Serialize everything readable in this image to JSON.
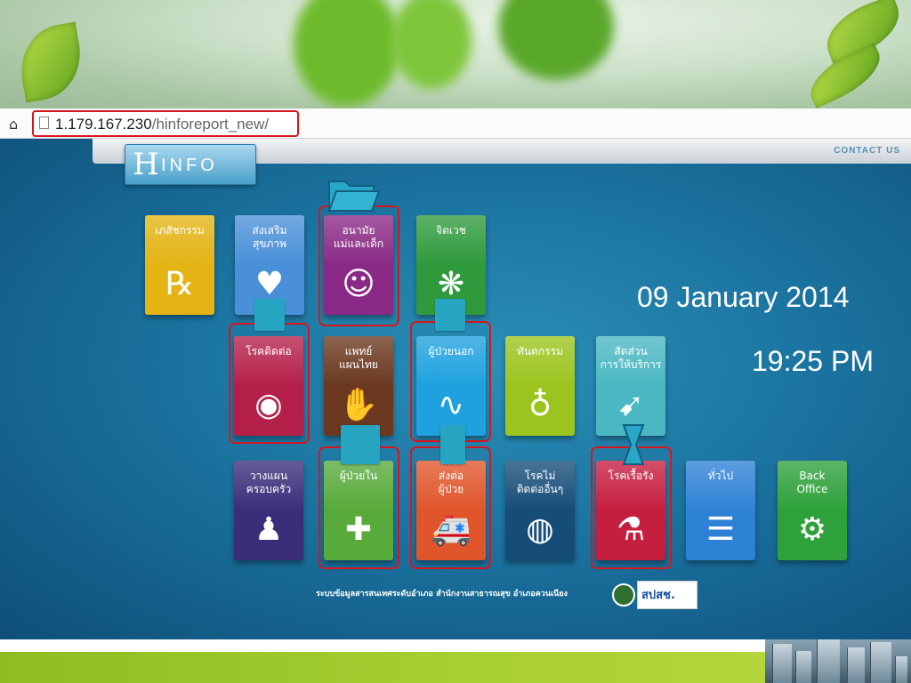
{
  "browser": {
    "home_icon": "home-icon",
    "url_host": "1.179.167.230",
    "url_path": "/hinforeport_new/"
  },
  "header": {
    "logo_first": "H",
    "logo_rest": "INFO",
    "contact_label": "CONTACT US"
  },
  "datetime": {
    "date": "09 January 2014",
    "time": "19:25 PM"
  },
  "tiles": [
    {
      "label": "เภสัชกรรม",
      "icon": "rx-icon",
      "glyph": "℞",
      "color": "#e3b414"
    },
    {
      "label": "ส่งเสริม\nสุขภาพ",
      "icon": "heart-icon",
      "glyph": "♥",
      "color": "#4a90d8"
    },
    {
      "label": "อนามัย\nแม่และเด็ก",
      "icon": "mother-child-icon",
      "glyph": "☺",
      "color": "#8a2a86"
    },
    {
      "label": "จิตเวช",
      "icon": "mind-icon",
      "glyph": "❋",
      "color": "#2f9a3c"
    },
    {
      "label": "โรคติดต่อ",
      "icon": "germ-icon",
      "glyph": "◉",
      "color": "#b5204a"
    },
    {
      "label": "แพทย์\nแผนไทย",
      "icon": "massage-icon",
      "glyph": "✋",
      "color": "#6b3820"
    },
    {
      "label": "ผู้ป่วยนอก",
      "icon": "stethoscope-icon",
      "glyph": "∿",
      "color": "#1ea1de"
    },
    {
      "label": "ทันตกรรม",
      "icon": "tooth-icon",
      "glyph": "♁",
      "color": "#9bc41e"
    },
    {
      "label": "สัดส่วน\nการให้บริการ",
      "icon": "runner-icon",
      "glyph": "➹",
      "color": "#4ab7c2"
    },
    {
      "label": "วางแผน\nครอบครัว",
      "icon": "family-icon",
      "glyph": "♟",
      "color": "#3a2e7a"
    },
    {
      "label": "ผู้ป่วยใน",
      "icon": "hospital-icon",
      "glyph": "✚",
      "color": "#58aa3a"
    },
    {
      "label": "ส่งต่อ\nผู้ป่วย",
      "icon": "ambulance-icon",
      "glyph": "🚑",
      "color": "#e0552a"
    },
    {
      "label": "โรคไม่\nติดต่ออื่นๆ",
      "icon": "blood-pressure-icon",
      "glyph": "◍",
      "color": "#164d78"
    },
    {
      "label": "โรคเรื้อรัง",
      "icon": "microscope-icon",
      "glyph": "⚗",
      "color": "#c61e3f"
    },
    {
      "label": "ทั่วไป",
      "icon": "document-icon",
      "glyph": "☰",
      "color": "#2e82d6"
    },
    {
      "label": "Back\nOffice",
      "icon": "gear-icon",
      "glyph": "⚙",
      "color": "#2ea13a"
    }
  ],
  "footer": {
    "text": "ระบบข้อมูลสารสนเทศระดับอำเภอ สำนักงานสาธารณสุข อำเภอควนเนียง",
    "logo_text": "สปสช."
  }
}
